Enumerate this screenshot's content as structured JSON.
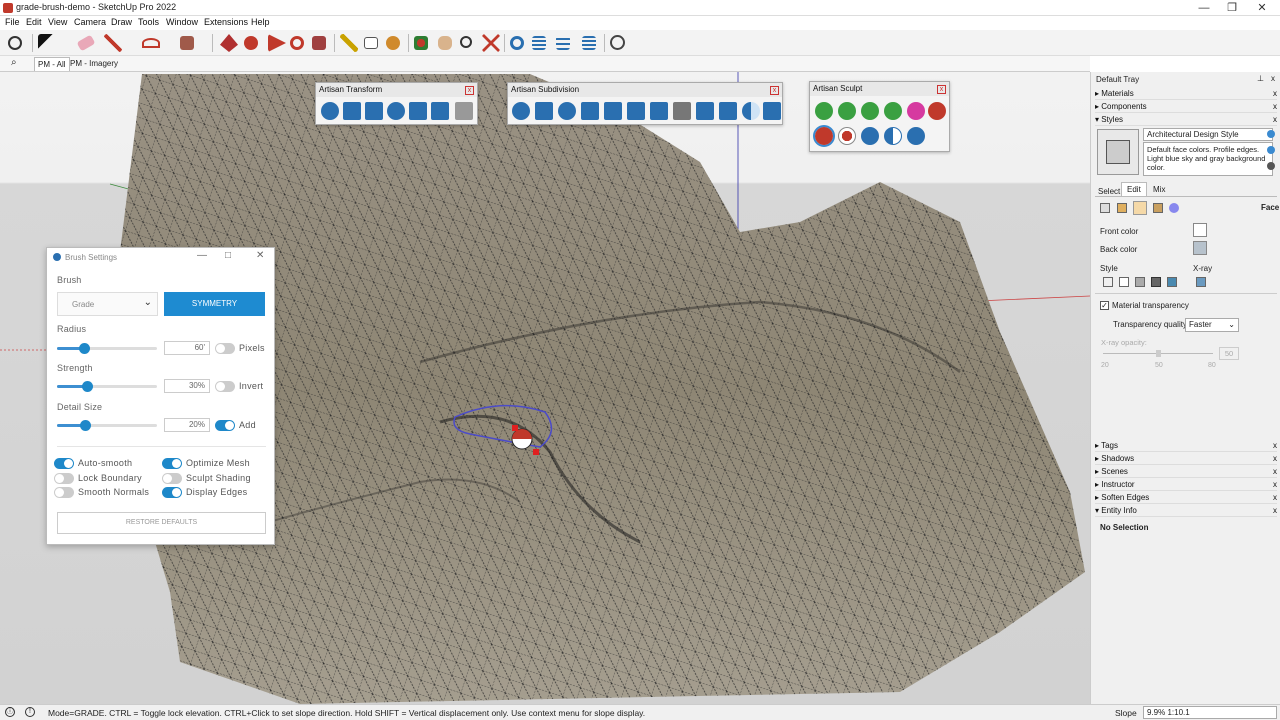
{
  "window": {
    "title": "grade-brush-demo - SketchUp Pro 2022",
    "min": "—",
    "max": "❐",
    "close": "✕"
  },
  "menu": [
    "File",
    "Edit",
    "View",
    "Camera",
    "Draw",
    "Tools",
    "Window",
    "Extensions",
    "Help"
  ],
  "scenes": [
    "PM - All",
    "PM - Imagery"
  ],
  "toolbars": {
    "transform": {
      "title": "Artisan Transform",
      "close": "x"
    },
    "subdivision": {
      "title": "Artisan Subdivision",
      "close": "x"
    },
    "sculpt": {
      "title": "Artisan Sculpt",
      "close": "x"
    }
  },
  "brush": {
    "title": "Brush Settings",
    "brush_label": "Brush",
    "brush_value": "Grade",
    "symmetry": "SYMMETRY",
    "radius_label": "Radius",
    "radius_value": "60'",
    "radius_level": 0.27,
    "pixels": "Pixels",
    "strength_label": "Strength",
    "strength_value": "30%",
    "strength_level": 0.3,
    "invert": "Invert",
    "detail_label": "Detail Size",
    "detail_value": "20%",
    "detail_level": 0.28,
    "add": "Add",
    "options": [
      {
        "label": "Auto-smooth",
        "on": true
      },
      {
        "label": "Optimize Mesh",
        "on": true
      },
      {
        "label": "Lock Boundary",
        "on": false
      },
      {
        "label": "Sculpt Shading",
        "on": false
      },
      {
        "label": "Smooth Normals",
        "on": false
      },
      {
        "label": "Display Edges",
        "on": true
      }
    ],
    "restore": "RESTORE DEFAULTS"
  },
  "tray": {
    "title": "Default Tray",
    "pin": "⊥",
    "close": "x",
    "sections_top": [
      "Materials",
      "Components",
      "Styles"
    ],
    "style_name": "Architectural Design Style",
    "style_desc": "Default face colors. Profile edges. Light blue sky and gray background color.",
    "tabs": [
      "Select",
      "Edit",
      "Mix"
    ],
    "face": "Face",
    "front_color": "Front color",
    "back_color": "Back color",
    "style": "Style",
    "xray": "X-ray",
    "material_transparency": "Material transparency",
    "transparency_quality": "Transparency quality:",
    "quality_value": "Faster",
    "xray_opacity": "X-ray opacity:",
    "xray_value": "50",
    "ticks": [
      "20",
      "50",
      "80"
    ],
    "sections_bottom": [
      "Tags",
      "Shadows",
      "Scenes",
      "Instructor",
      "Soften Edges",
      "Entity Info"
    ],
    "no_selection": "No Selection"
  },
  "status": {
    "message": "Mode=GRADE.  CTRL = Toggle lock elevation. CTRL+Click to set slope direction. Hold SHIFT = Vertical displacement only. Use context menu for slope display.",
    "field_label": "Slope",
    "field_value": "9.9%  1:10.1"
  },
  "colors": {
    "accent": "#1e88c9",
    "front_face": "#ffffff",
    "back_face": "#b7c2cc"
  }
}
